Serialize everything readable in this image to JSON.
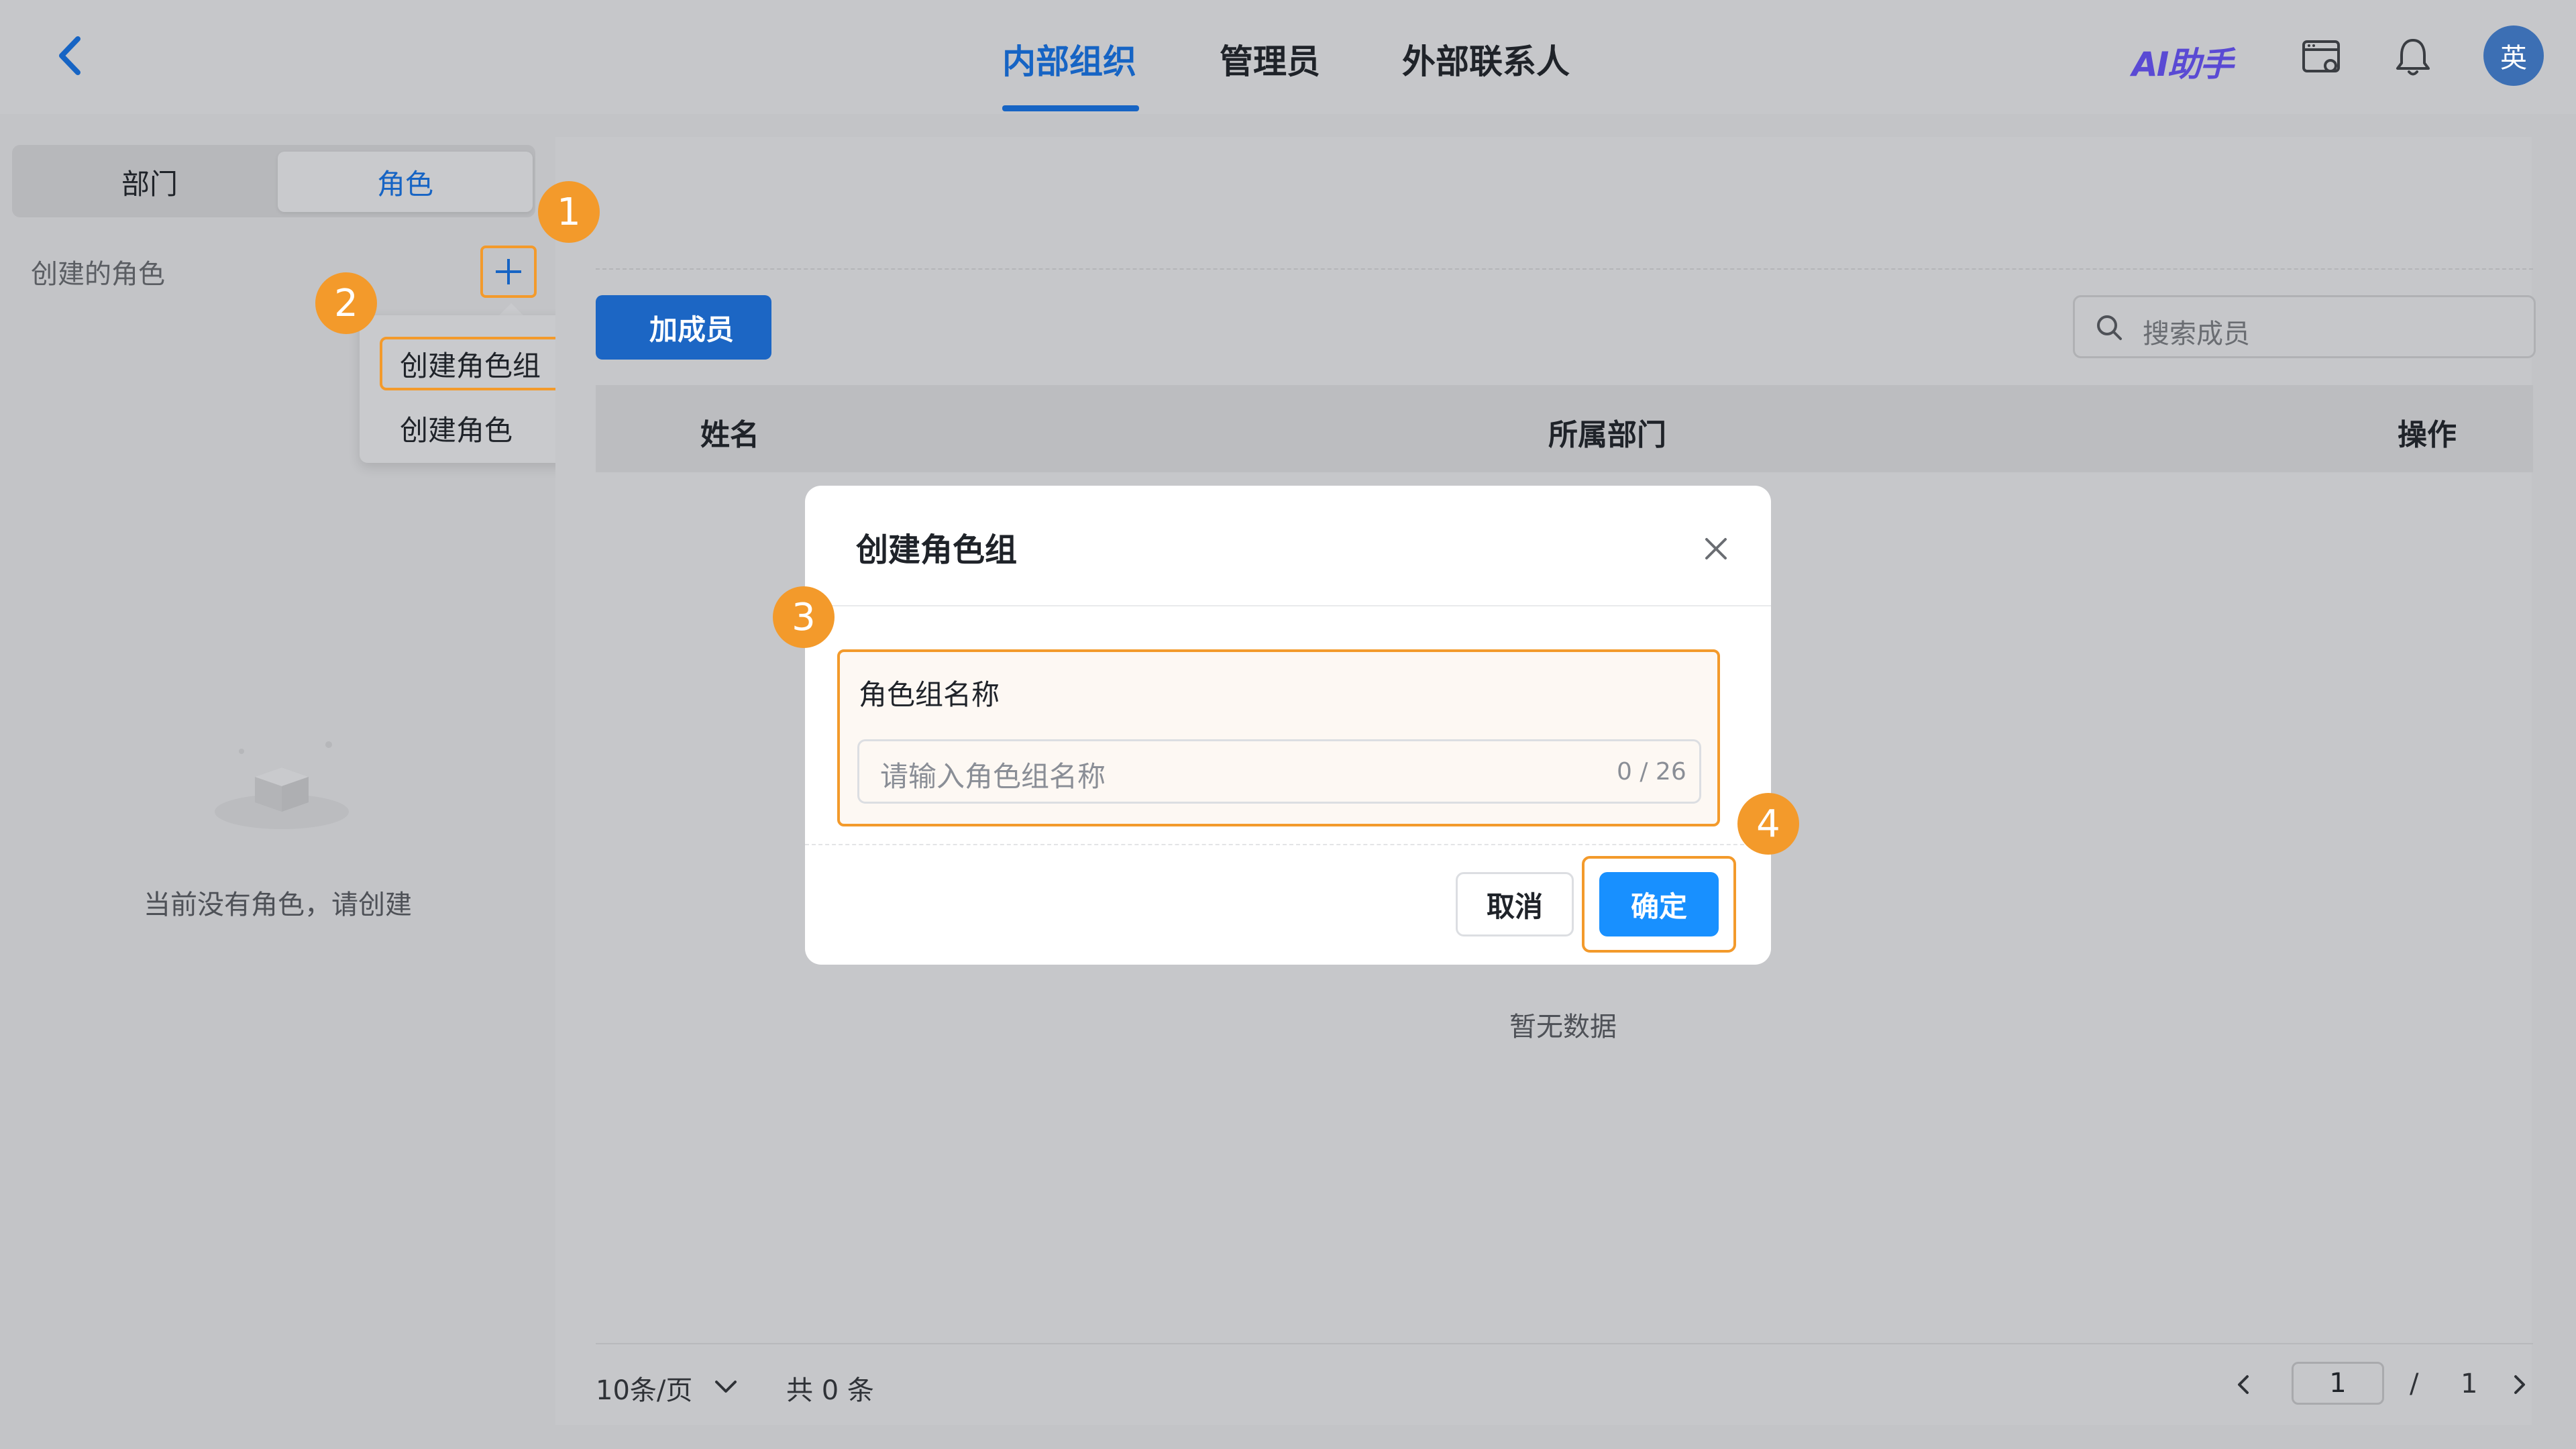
{
  "header": {
    "tabs": [
      {
        "label": "内部组织",
        "active": true
      },
      {
        "label": "管理员",
        "active": false
      },
      {
        "label": "外部联系人",
        "active": false
      }
    ],
    "ai_assistant_label": "AI助手",
    "avatar_text": "英",
    "icons": [
      "back-arrow-icon",
      "settings-window-icon",
      "bell-icon"
    ]
  },
  "sidebar": {
    "segments": [
      {
        "label": "部门",
        "active": false
      },
      {
        "label": "角色",
        "active": true
      }
    ],
    "section_label": "创建的角色",
    "add_menu": {
      "items": [
        "创建角色组",
        "创建角色"
      ],
      "highlighted": "创建角色组"
    },
    "empty_text": "当前没有角色，请创建"
  },
  "main": {
    "add_member_label": "添加成员",
    "add_member_visible": "加成员",
    "search_placeholder": "搜索成员",
    "table": {
      "columns": [
        "姓名",
        "所属部门",
        "操作"
      ],
      "rows": []
    },
    "empty_text": "暂无数据",
    "pagination": {
      "page_size": "10条/页",
      "total": "共 0 条",
      "current_page": "1",
      "separator": "/",
      "total_pages": "1"
    }
  },
  "modal": {
    "title": "创建角色组",
    "field_label": "角色组名称",
    "field_placeholder": "请输入角色组名称",
    "field_counter": "0 / 26",
    "cancel_label": "取消",
    "confirm_label": "确定"
  },
  "steps": [
    "1",
    "2",
    "3",
    "4"
  ],
  "colors": {
    "accent": "#1664c4",
    "primary_button": "#1890ff",
    "highlight_orange": "#f39a2b"
  }
}
